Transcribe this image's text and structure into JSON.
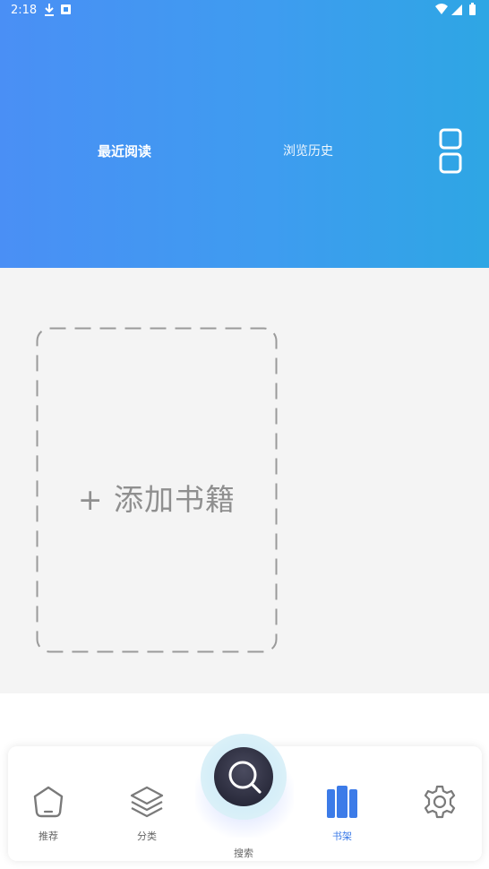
{
  "status_bar": {
    "time": "2:18"
  },
  "header": {
    "tabs": [
      {
        "label": "最近阅读",
        "active": true
      },
      {
        "label": "浏览历史",
        "active": false
      }
    ],
    "layout_toggle_icon": "grid-layout-icon"
  },
  "shelf": {
    "add_book_label": "+ 添加书籍"
  },
  "bottom_nav": {
    "items": [
      {
        "label": "推荐",
        "icon": "home-icon",
        "active": false
      },
      {
        "label": "分类",
        "icon": "layers-icon",
        "active": false
      },
      {
        "label": "搜索",
        "icon": "search-icon",
        "active": false
      },
      {
        "label": "书架",
        "icon": "bookshelf-icon",
        "active": true
      },
      {
        "label": "",
        "icon": "gear-icon",
        "active": false
      }
    ]
  },
  "colors": {
    "header_start": "#4a8ff5",
    "header_end": "#2ea6e4",
    "active_nav": "#3c7be8",
    "search_button": "#2a2b3c"
  }
}
